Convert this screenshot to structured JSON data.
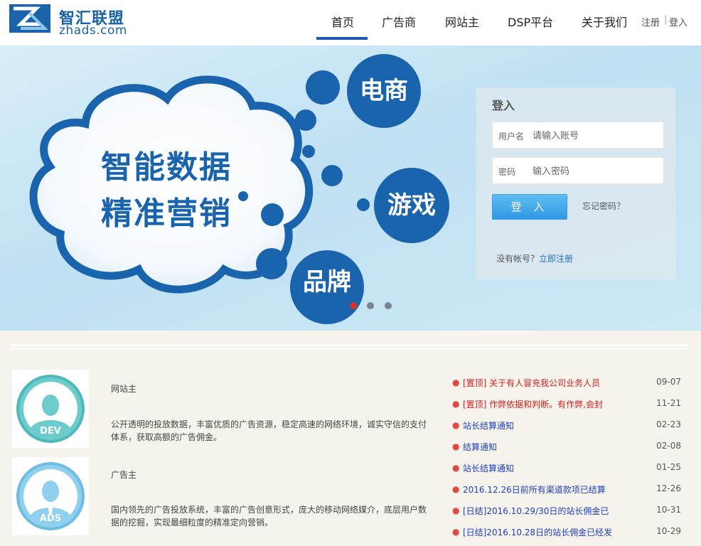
{
  "logo": {
    "cn": "智汇联盟",
    "en": "zhads.com"
  },
  "nav": [
    {
      "label": "首页",
      "active": true
    },
    {
      "label": "广告商",
      "active": false
    },
    {
      "label": "网站主",
      "active": false
    },
    {
      "label": "DSP平台",
      "active": false
    },
    {
      "label": "关于我们",
      "active": false
    }
  ],
  "auth": {
    "register": "注册",
    "separator": "|",
    "login": "登入"
  },
  "banner": {
    "cloud_line1": "智能数据",
    "cloud_line2": "精准营销",
    "bubbles": [
      "电商",
      "游戏",
      "品牌"
    ],
    "slides": 3,
    "active_slide": 1
  },
  "login": {
    "title": "登入",
    "username_label": "用户名",
    "username_placeholder": "请输入账号",
    "password_label": "密码",
    "password_placeholder": "输入密码",
    "submit": "登 入",
    "forgot": "忘记密码？",
    "no_account": "没有帐号？",
    "register_now": "立即注册"
  },
  "roles": [
    {
      "badge": "DEV",
      "title": "网站主",
      "desc": "公开透明的投放数据，丰富优质的广告资源，稳定高速的网络环境，诚实守信的支付体系，获取高额的广告佣金。",
      "color": "#6dcbcb"
    },
    {
      "badge": "ADS",
      "title": "广告主",
      "desc": "国内领先的广告投放系统，丰富的广告创意形式，庞大的移动网络媒介，底层用户数据的挖掘，实现最细粒度的精准定向营销。",
      "color": "#8ed0ee"
    }
  ],
  "news": [
    {
      "title": "[置顶] 关于有人冒充我公司业务人员",
      "date": "09-07",
      "style": "red"
    },
    {
      "title": "[置顶] 作弊依据和判断。有作弊,会封",
      "date": "11-21",
      "style": "red"
    },
    {
      "title": "站长结算通知",
      "date": "02-23",
      "style": "blue"
    },
    {
      "title": "结算通知",
      "date": "02-08",
      "style": "blue"
    },
    {
      "title": "站长结算通知",
      "date": "01-25",
      "style": "blue"
    },
    {
      "title": "2016.12.26日前所有渠道款项已结算",
      "date": "12-26",
      "style": "blue"
    },
    {
      "title": "[日结]2016.10.29/30日的站长佣金已",
      "date": "10-31",
      "style": "blue"
    },
    {
      "title": "[日结]2016.10.28日的站长佣金已经发",
      "date": "10-29",
      "style": "blue"
    }
  ],
  "colors": {
    "brand": "#1a63ad",
    "nav_active": "#1b5bb3",
    "news_red": "#d81e1e",
    "news_blue": "#1f3fbf",
    "bullet": "#e34a3c"
  }
}
